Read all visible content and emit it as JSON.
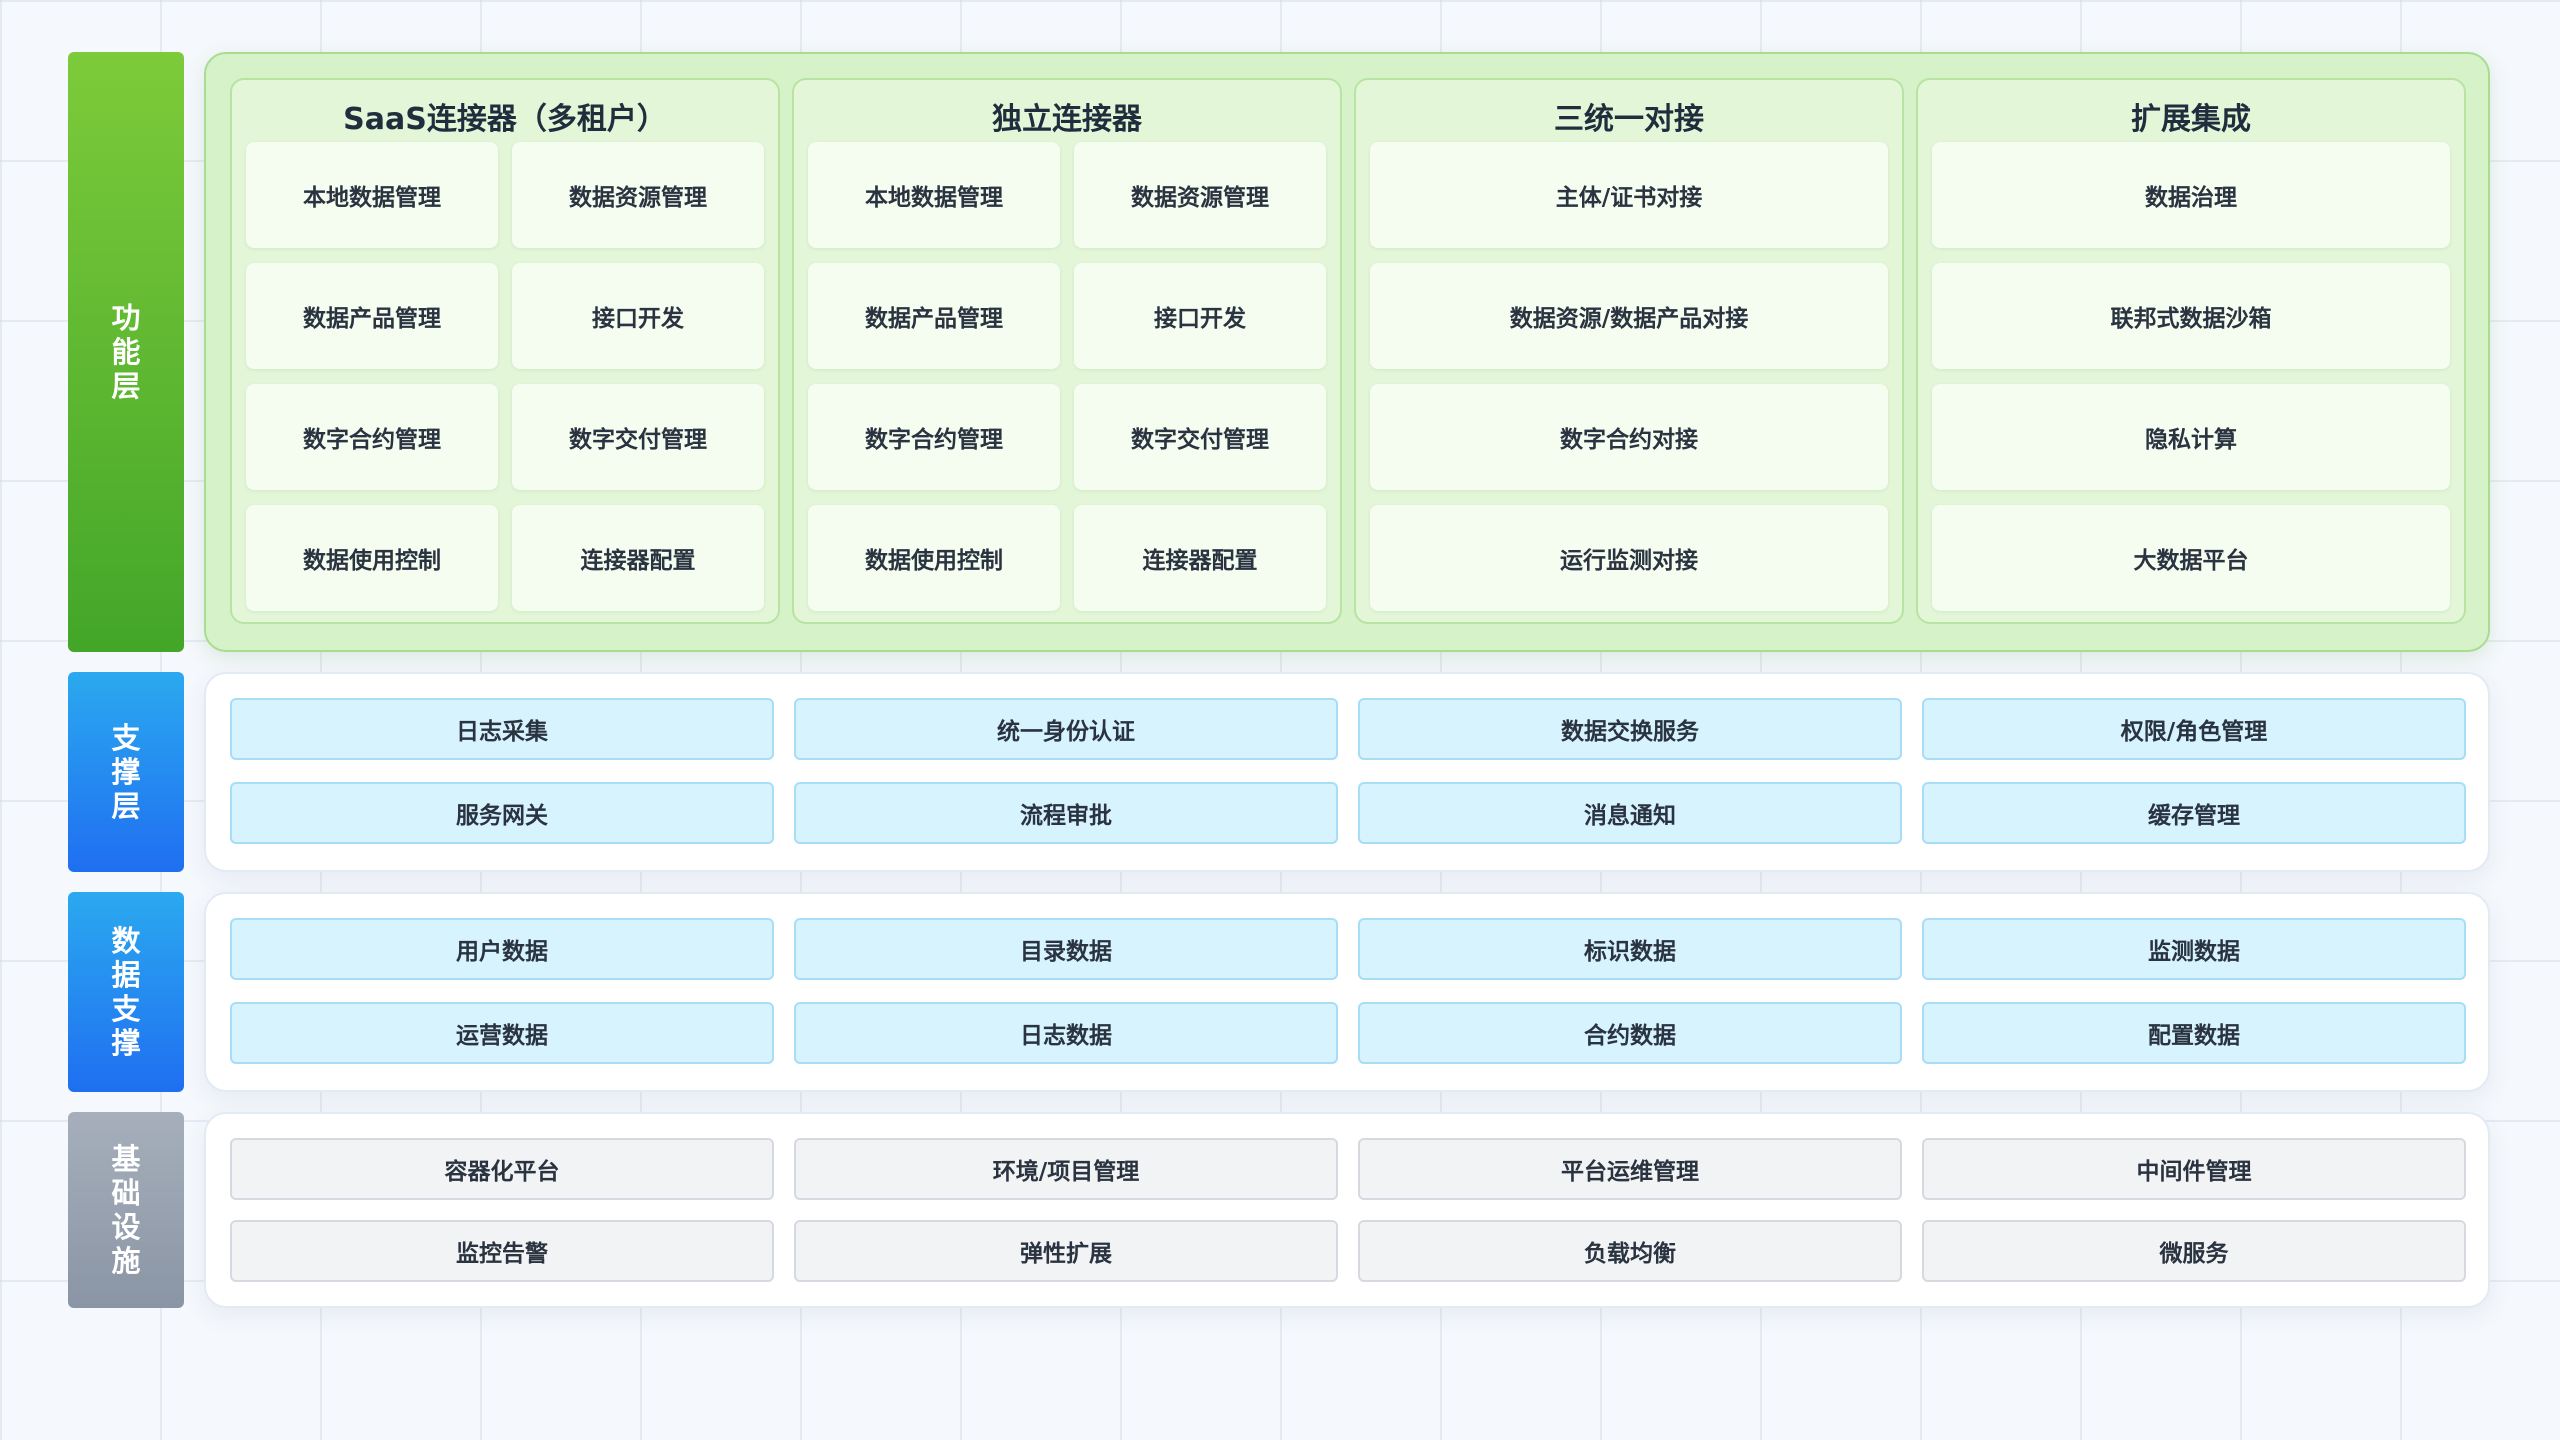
{
  "layers": {
    "function": {
      "label": [
        "功",
        "能",
        "层"
      ],
      "groups": [
        {
          "title": "SaaS连接器（多租户）",
          "items": [
            "本地数据管理",
            "数据资源管理",
            "数据产品管理",
            "接口开发",
            "数字合约管理",
            "数字交付管理",
            "数据使用控制",
            "连接器配置"
          ]
        },
        {
          "title": "独立连接器",
          "items": [
            "本地数据管理",
            "数据资源管理",
            "数据产品管理",
            "接口开发",
            "数字合约管理",
            "数字交付管理",
            "数据使用控制",
            "连接器配置"
          ]
        },
        {
          "title": "三统一对接",
          "items": [
            "主体/证书对接",
            "数据资源/数据产品对接",
            "数字合约对接",
            "运行监测对接"
          ]
        },
        {
          "title": "扩展集成",
          "items": [
            "数据治理",
            "联邦式数据沙箱",
            "隐私计算",
            "大数据平台"
          ]
        }
      ]
    },
    "support": {
      "label": [
        "支",
        "撑",
        "层"
      ],
      "items": [
        "日志采集",
        "统一身份认证",
        "数据交换服务",
        "权限/角色管理",
        "服务网关",
        "流程审批",
        "消息通知",
        "缓存管理"
      ]
    },
    "data_support": {
      "label": [
        "数",
        "据",
        "支",
        "撑"
      ],
      "items": [
        "用户数据",
        "目录数据",
        "标识数据",
        "监测数据",
        "运营数据",
        "日志数据",
        "合约数据",
        "配置数据"
      ]
    },
    "infrastructure": {
      "label": [
        "基",
        "础",
        "设",
        "施"
      ],
      "items": [
        "容器化平台",
        "环境/项目管理",
        "平台运维管理",
        "中间件管理",
        "监控告警",
        "弹性扩展",
        "负载均衡",
        "微服务"
      ]
    }
  }
}
